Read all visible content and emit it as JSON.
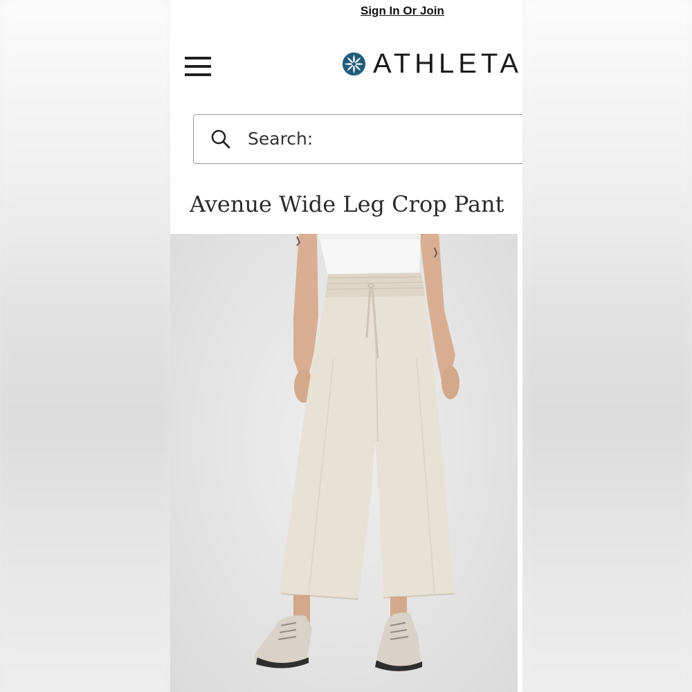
{
  "header": {
    "signin_label": "Sign In Or Join",
    "brand_name": "ATHLETA",
    "brand_color": "#1e5b7a"
  },
  "search": {
    "label": "Search:",
    "icon": "search-icon"
  },
  "product": {
    "title": "Avenue Wide Leg Crop Pant",
    "image_alt": "Model wearing cream wide leg crop pants with drawstring waist, white top and sneakers",
    "pant_color": "#e8e2d6"
  }
}
